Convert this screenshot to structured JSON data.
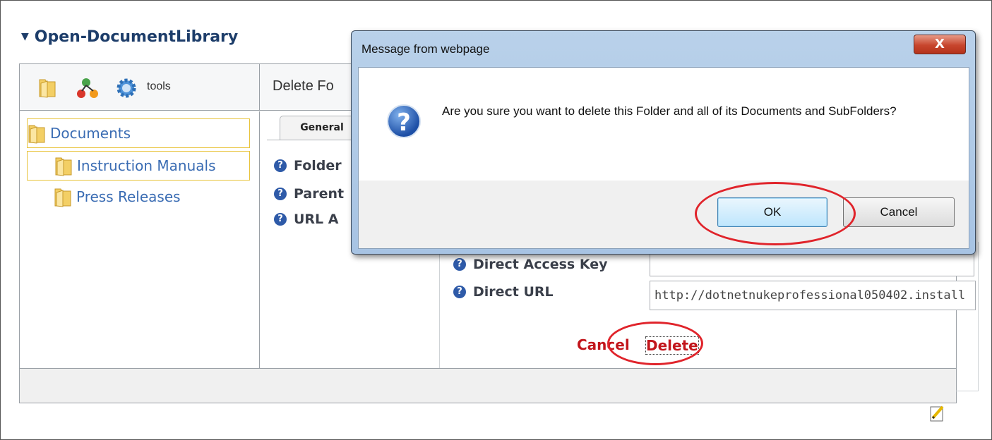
{
  "module": {
    "title": "Open-DocumentLibrary",
    "expand_glyph": "▼"
  },
  "toolbar": {
    "tools_label": "tools",
    "icons": [
      "folder-icon",
      "network-icon",
      "gear-icon"
    ]
  },
  "right_header": {
    "title": "Delete Fo"
  },
  "tree": {
    "items": [
      {
        "label": "Documents",
        "selected": true
      },
      {
        "label": "Instruction Manuals",
        "selected": true
      },
      {
        "label": "Press Releases",
        "selected": false
      }
    ]
  },
  "tabs": {
    "general": "General"
  },
  "fields": {
    "folder": "Folder",
    "parent": "Parent",
    "url_access": "URL A",
    "direct_access_key": "Direct Access Key",
    "direct_access_key_value": "",
    "direct_url": "Direct URL",
    "direct_url_value": "http://dotnetnukeprofessional050402.install"
  },
  "actions": {
    "cancel": "Cancel",
    "delete": "Delete"
  },
  "dialog": {
    "title": "Message from webpage",
    "close": "X",
    "message": "Are you sure you want to delete this Folder and all of its Documents and SubFolders?",
    "ok": "OK",
    "cancel": "Cancel"
  },
  "colors": {
    "accent_red": "#e0242b",
    "link_blue": "#3a6cb3",
    "title_navy": "#1d3d6a"
  }
}
